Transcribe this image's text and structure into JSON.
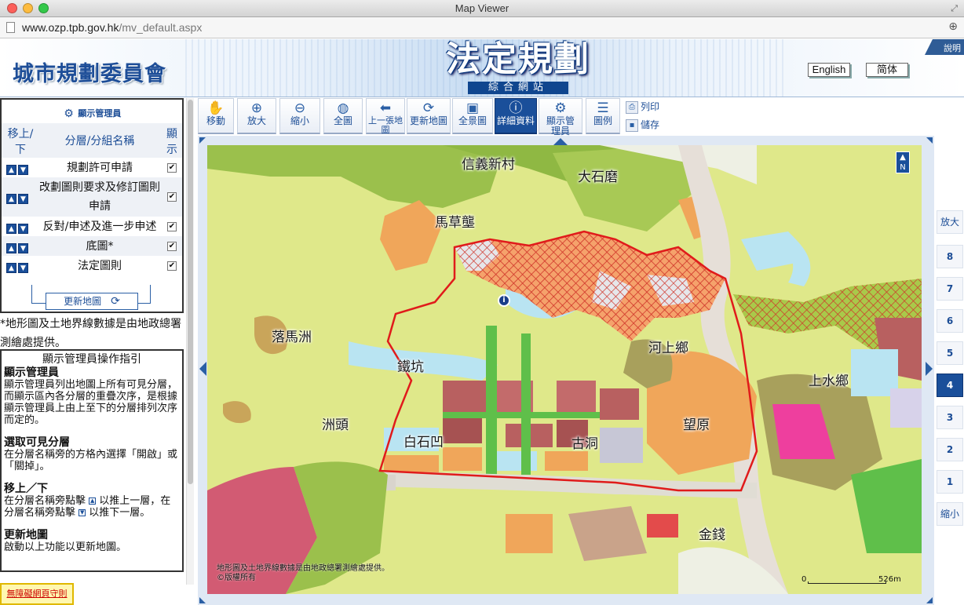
{
  "window": {
    "title": "Map Viewer"
  },
  "browser": {
    "url_host": "www.ozp.tpb.gov.hk",
    "url_path": "/mv_default.aspx"
  },
  "header": {
    "org_name": "城市規劃委員會",
    "site_title": "法定規劃",
    "site_subtitle": "綜合網站",
    "help_label": "說明",
    "lang_english": "English",
    "lang_simplified": "简体"
  },
  "display_manager": {
    "title": "顯示管理員",
    "col_move": "移上/下",
    "col_name": "分層/分組名稱",
    "col_show": "顯示",
    "layers": [
      {
        "name": "規劃許可申請",
        "checked": true
      },
      {
        "name": "改劃圖則要求及修訂圖則申請",
        "checked": true
      },
      {
        "name": "反對/申述及進一步申述",
        "checked": true
      },
      {
        "name": "底圖*",
        "checked": true
      },
      {
        "name": "法定圖則",
        "checked": true
      }
    ],
    "update_label": "更新地圖"
  },
  "note": "*地形圖及土地界線數據是由地政總署測繪處提供。",
  "guide": {
    "title": "顯示管理員操作指引",
    "sections": [
      {
        "heading": "顯示管理員",
        "body": "顯示管理員列出地圖上所有可見分層，而顯示區內各分層的重疊次序，是根據顯示管理員上由上至下的分層排列次序而定的。"
      },
      {
        "heading": "選取可見分層",
        "body": "在分層名稱旁的方格內選擇「開啟」或「關掉」。"
      },
      {
        "heading": "移上／下",
        "body_a": "在分層名稱旁點擊",
        "body_b": "以推上一層，在分層名稱旁點擊",
        "body_c": "以推下一層。"
      },
      {
        "heading": "更新地圖",
        "body": "啟動以上功能以更新地圖。"
      }
    ]
  },
  "accessibility_link": "無障礙網頁守則",
  "toolbar": {
    "tools": [
      {
        "id": "pan",
        "label": "移動",
        "icon": "hand-icon"
      },
      {
        "id": "zoomin",
        "label": "放大",
        "icon": "zoom-in-icon"
      },
      {
        "id": "zoomout",
        "label": "縮小",
        "icon": "zoom-out-icon"
      },
      {
        "id": "full",
        "label": "全圖",
        "icon": "globe-icon"
      },
      {
        "id": "prev",
        "label": "上一張地圖",
        "icon": "arrow-left-icon"
      },
      {
        "id": "refresh",
        "label": "更新地圖",
        "icon": "refresh-icon"
      },
      {
        "id": "overview",
        "label": "全景圖",
        "icon": "overview-icon"
      },
      {
        "id": "identify",
        "label": "詳細資料",
        "icon": "info-icon"
      },
      {
        "id": "dm",
        "label": "顯示管理員",
        "icon": "display-manager-icon"
      },
      {
        "id": "legend",
        "label": "圖例",
        "icon": "legend-icon"
      }
    ],
    "print_label": "列印",
    "save_label": "儲存"
  },
  "map": {
    "places": [
      "信義新村",
      "大石磨",
      "馬草壟",
      "落馬洲",
      "河上鄉",
      "鐵坑",
      "上水鄉",
      "洲頭",
      "白石凹",
      "古洞",
      "望原",
      "金錢"
    ],
    "copyright_line1": "地形圖及土地界線數據是由地政總署測繪處提供。",
    "copyright_line2": "©版權所有",
    "scale_zero": "0",
    "scale_value": "526m",
    "north_label": "N"
  },
  "zoombar": {
    "zoom_in": "放大",
    "levels": [
      "8",
      "7",
      "6",
      "5",
      "4",
      "3",
      "2",
      "1"
    ],
    "current": "4",
    "zoom_out": "縮小"
  }
}
